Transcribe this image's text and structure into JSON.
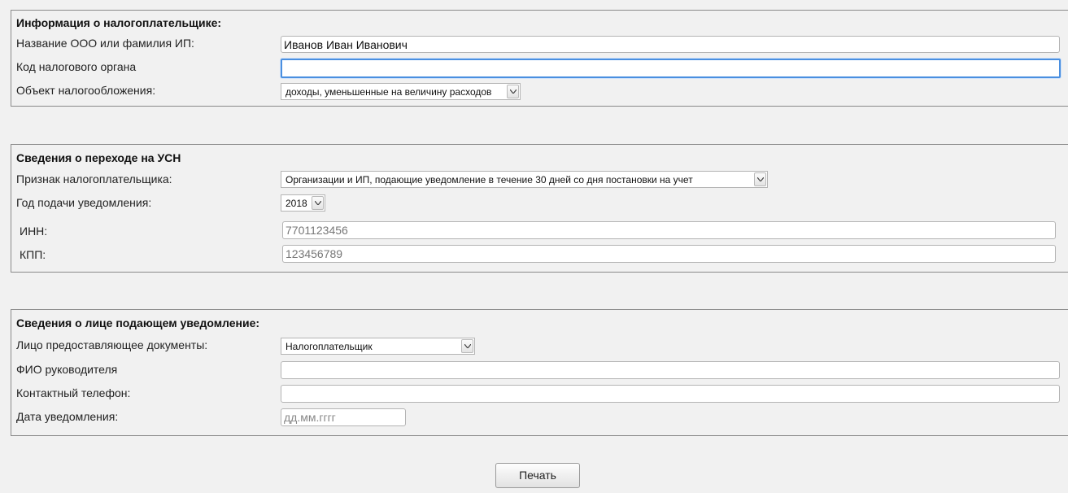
{
  "taxpayer_info": {
    "title": "Информация о налогоплательщике:",
    "name_label": "Название ООО или фамилия ИП:",
    "name_value": "Иванов Иван Иванович",
    "tax_office_label": "Код налогового органа",
    "tax_office_value": "",
    "taxation_object_label": "Объект налогообложения:",
    "taxation_object_selected": "доходы, уменьшенные на величину расходов"
  },
  "usn_transition": {
    "title": "Сведения о переходе на УСН",
    "taxpayer_sign_label": "Признак налогоплательщика:",
    "taxpayer_sign_selected": "Организации и ИП, подающие уведомление в течение 30 дней со дня постановки на учет",
    "year_label": "Год подачи уведомления:",
    "year_selected": "2018",
    "inn_label": "ИНН:",
    "inn_value": "7701123456",
    "kpp_label": "КПП:",
    "kpp_value": "123456789"
  },
  "submitter_info": {
    "title": "Сведения о лице подающем уведомление:",
    "submitter_label": "Лицо предоставляющее документы:",
    "submitter_selected": "Налогоплательщик",
    "director_label": "ФИО руководителя",
    "director_value": "",
    "phone_label": "Контактный телефон:",
    "phone_value": "",
    "date_label": "Дата уведомления:",
    "date_placeholder": "дд.мм.гггг"
  },
  "actions": {
    "print_label": "Печать"
  }
}
